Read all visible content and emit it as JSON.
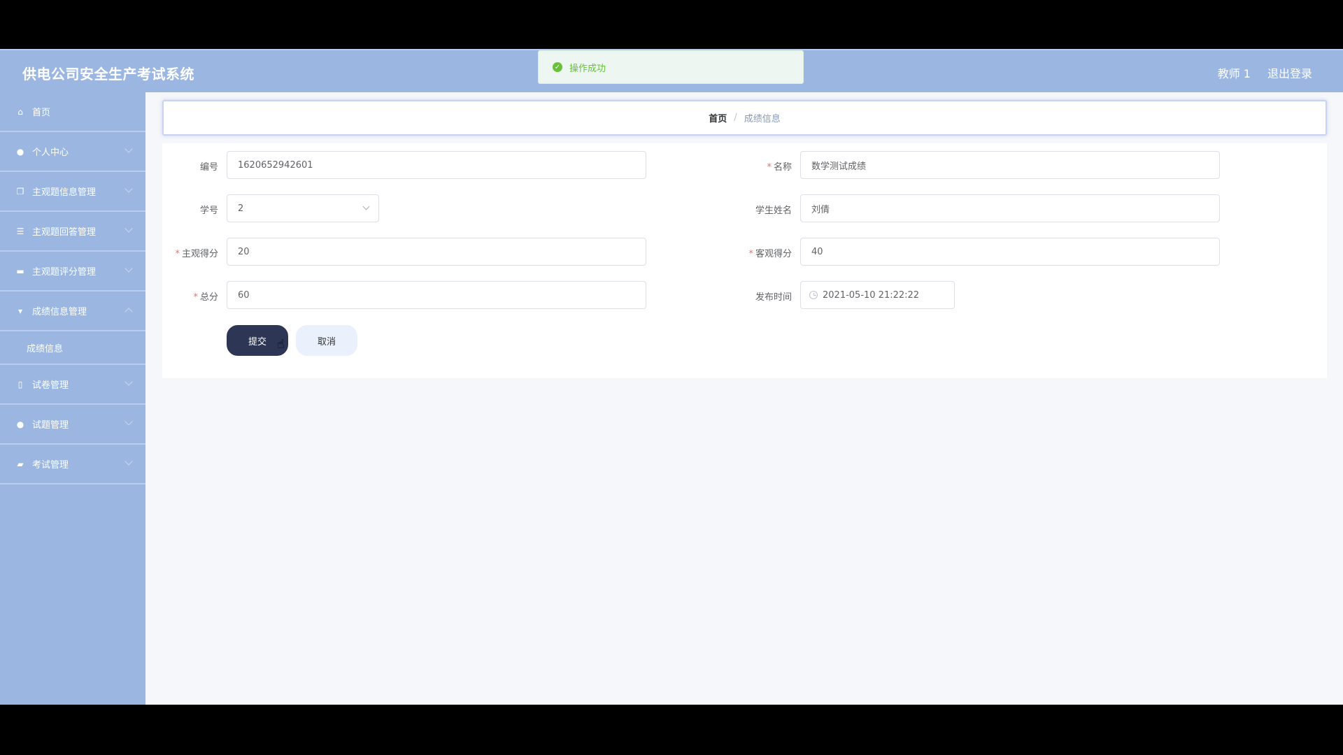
{
  "app": {
    "title": "供电公司安全生产考试系统"
  },
  "header": {
    "user": "教师 1",
    "logout": "退出登录"
  },
  "toast": {
    "message": "操作成功"
  },
  "sidebar": {
    "items": [
      {
        "label": "首页",
        "icon": "home-icon"
      },
      {
        "label": "个人中心",
        "icon": "user-icon"
      },
      {
        "label": "主观题信息管理",
        "icon": "copy-icon"
      },
      {
        "label": "主观题回答管理",
        "icon": "list-icon"
      },
      {
        "label": "主观题评分管理",
        "icon": "briefcase-icon"
      },
      {
        "label": "成绩信息管理",
        "icon": "trophy-icon"
      },
      {
        "label": "试卷管理",
        "icon": "mic-icon"
      },
      {
        "label": "试题管理",
        "icon": "user-icon"
      },
      {
        "label": "考试管理",
        "icon": "case-icon"
      }
    ],
    "subitem": {
      "label": "成绩信息"
    }
  },
  "breadcrumb": {
    "home": "首页",
    "separator": "/",
    "current": "成绩信息"
  },
  "form": {
    "id": {
      "label": "编号",
      "value": "1620652942601"
    },
    "name": {
      "label": "名称",
      "value": "数学测试成绩"
    },
    "student_no": {
      "label": "学号",
      "value": "2"
    },
    "student_name": {
      "label": "学生姓名",
      "value": "刘倩"
    },
    "subjective_score": {
      "label": "主观得分",
      "value": "20"
    },
    "objective_score": {
      "label": "客观得分",
      "value": "40"
    },
    "total": {
      "label": "总分",
      "value": "60"
    },
    "publish_time": {
      "label": "发布时间",
      "value": "2021-05-10 21:22:22"
    },
    "required_mark": "*"
  },
  "buttons": {
    "submit": "提交",
    "cancel": "取消"
  },
  "colors": {
    "header_bg": "#9ab6e1",
    "primary_button": "#2e3656",
    "success": "#67c23a"
  }
}
